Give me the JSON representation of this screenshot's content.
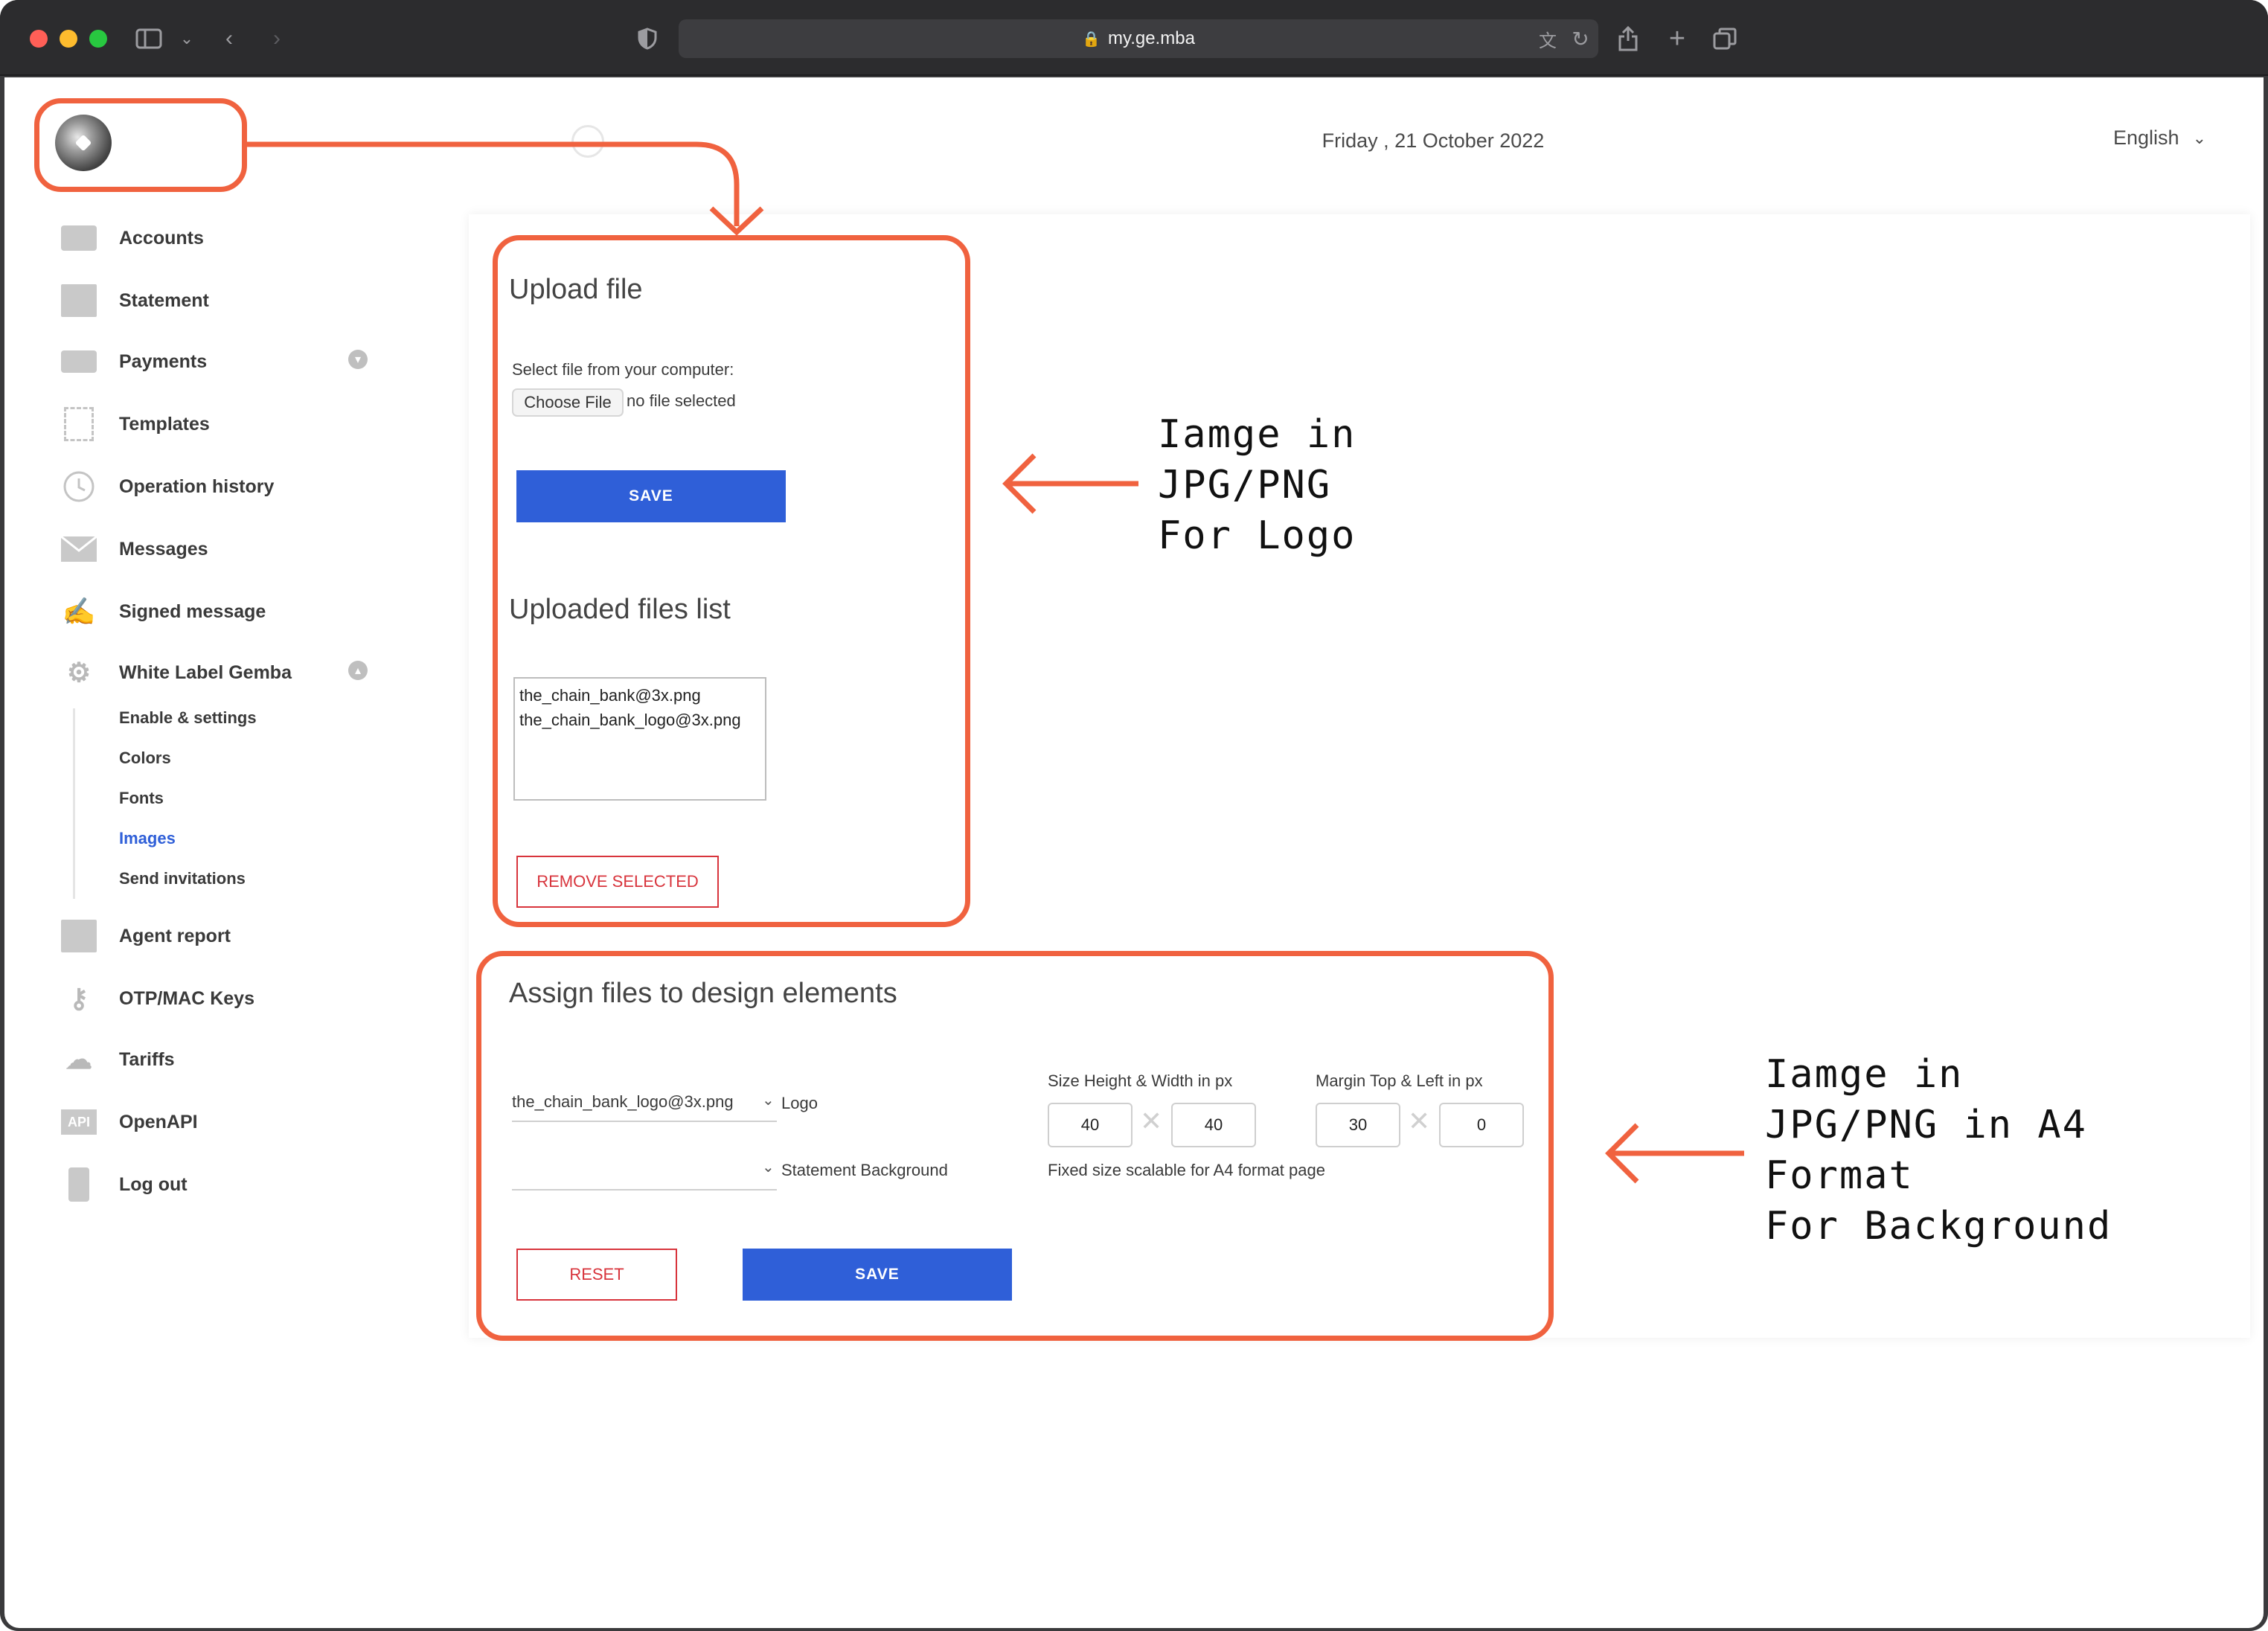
{
  "browser": {
    "url": "my.ge.mba",
    "controls": {
      "close_color": "#ff5f57",
      "minimize_color": "#febc2e",
      "maximize_color": "#28c840"
    }
  },
  "header": {
    "date": "Friday , 21 October 2022",
    "language": "English"
  },
  "sidebar": {
    "items": [
      {
        "label": "Accounts",
        "icon": "wallet-icon"
      },
      {
        "label": "Statement",
        "icon": "statement-icon"
      },
      {
        "label": "Payments",
        "icon": "payments-icon"
      },
      {
        "label": "Templates",
        "icon": "templates-icon"
      },
      {
        "label": "Operation history",
        "icon": "history-icon"
      },
      {
        "label": "Messages",
        "icon": "envelope-icon"
      },
      {
        "label": "Signed message",
        "icon": "signature-icon"
      },
      {
        "label": "White Label Gemba",
        "icon": "gear-icon"
      },
      {
        "label": "Agent report",
        "icon": "report-icon"
      },
      {
        "label": "OTP/MAC Keys",
        "icon": "keys-icon"
      },
      {
        "label": "Tariffs",
        "icon": "tariffs-icon"
      },
      {
        "label": "OpenAPI",
        "icon": "api-icon"
      },
      {
        "label": "Log out",
        "icon": "logout-icon"
      }
    ],
    "subitems": [
      {
        "label": "Enable & settings"
      },
      {
        "label": "Colors"
      },
      {
        "label": "Fonts"
      },
      {
        "label": "Images",
        "active": true
      },
      {
        "label": "Send invitations"
      }
    ],
    "api_badge": "API"
  },
  "upload": {
    "title": "Upload file",
    "select_label": "Select file from your computer:",
    "choose_button": "Choose File",
    "no_file": "no file selected",
    "save_button": "SAVE"
  },
  "files": {
    "title": "Uploaded files list",
    "items": [
      "the_chain_bank@3x.png",
      "the_chain_bank_logo@3x.png"
    ],
    "remove_button": "REMOVE SELECTED"
  },
  "assign": {
    "title": "Assign files to design elements",
    "logo_select_value": "the_chain_bank_logo@3x.png",
    "logo_label": "Logo",
    "background_select_value": "",
    "background_label": "Statement Background",
    "size_label": "Size Height & Width in px",
    "size_height": "40",
    "size_width": "40",
    "margin_label": "Margin Top & Left in px",
    "margin_top": "30",
    "margin_left": "0",
    "size_note": "Fixed size scalable for A4 format page",
    "reset_button": "RESET",
    "save_button": "SAVE"
  },
  "annotations": {
    "logo_note": [
      "Iamge in",
      "JPG/PNG",
      "For Logo"
    ],
    "background_note": [
      "Iamge in",
      "JPG/PNG in A4",
      "Format",
      "For Background"
    ],
    "accent_color": "#f0623f"
  }
}
